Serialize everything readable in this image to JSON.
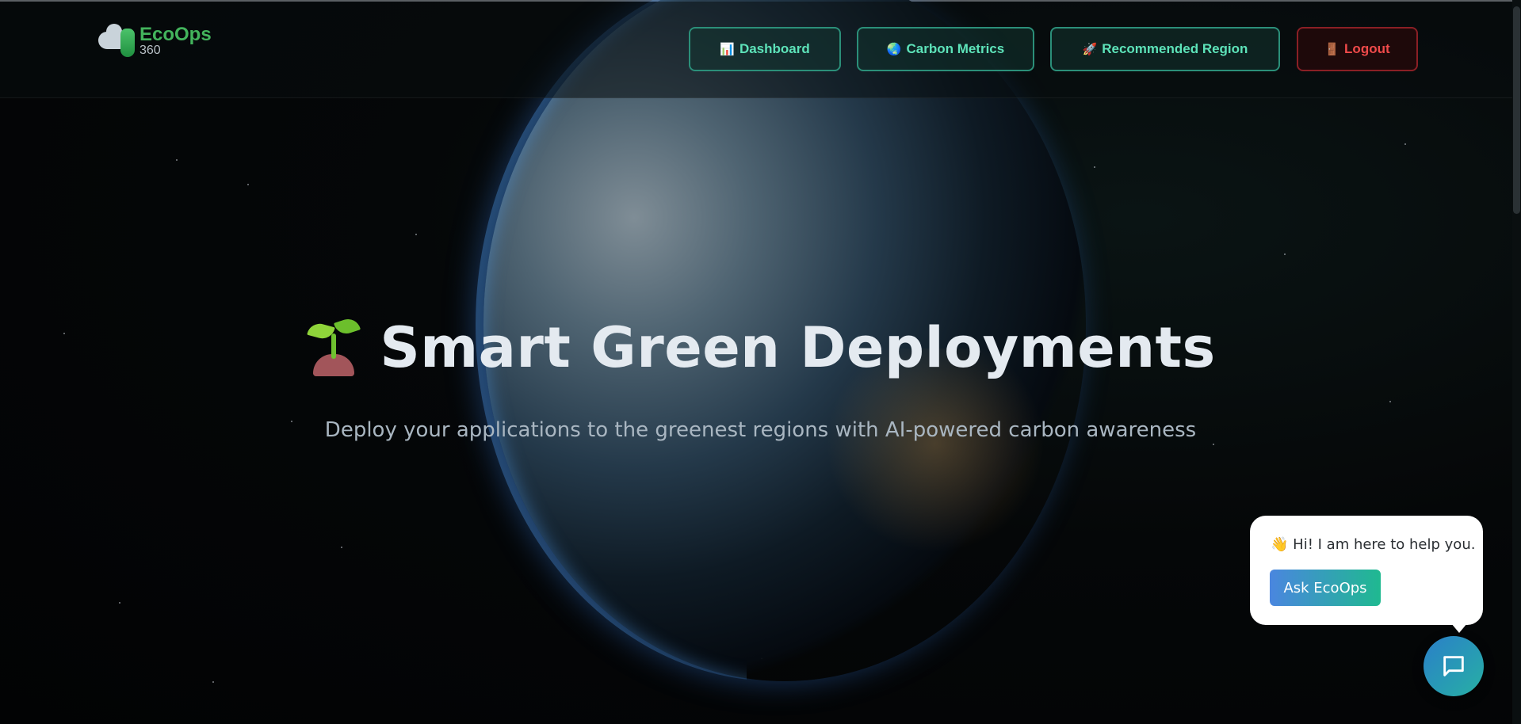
{
  "logo": {
    "title": "EcoOps",
    "subtitle": "360"
  },
  "nav": {
    "dashboard": {
      "icon": "bar-chart-icon",
      "glyph": "📊",
      "label": "Dashboard"
    },
    "carbon_metrics": {
      "icon": "globe-icon",
      "glyph": "🌏",
      "label": "Carbon Metrics"
    },
    "recommended_region": {
      "icon": "rocket-icon",
      "glyph": "🚀",
      "label": "Recommended Region"
    },
    "logout": {
      "icon": "door-icon",
      "glyph": "🚪",
      "label": "Logout"
    }
  },
  "hero": {
    "title": "Smart Green Deployments",
    "subtitle": "Deploy your applications to the greenest regions with AI-powered carbon awareness"
  },
  "chat": {
    "wave_glyph": "👋",
    "message": "Hi! I am here to help you.",
    "button_label": "Ask EcoOps"
  },
  "colors": {
    "accent_green": "#5de3b9",
    "logout_red": "#ef4a4a",
    "brand_green": "#43b45c"
  }
}
